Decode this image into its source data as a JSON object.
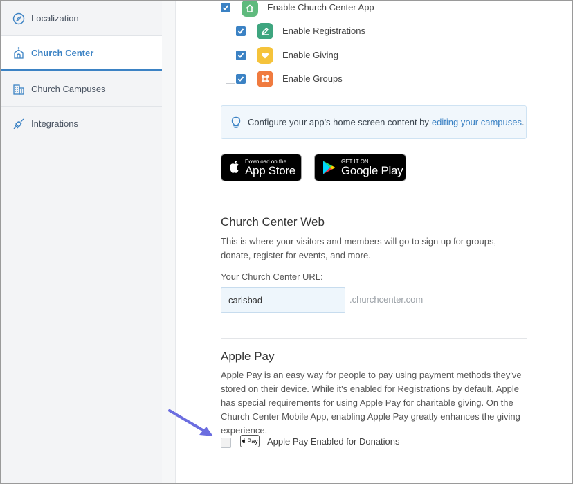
{
  "sidebar": {
    "items": [
      {
        "label": "Localization",
        "icon": "compass-icon"
      },
      {
        "label": "Church Center",
        "icon": "church-icon",
        "active": true
      },
      {
        "label": "Church Campuses",
        "icon": "building-icon"
      },
      {
        "label": "Integrations",
        "icon": "plug-icon"
      }
    ]
  },
  "app_options": {
    "main": {
      "label": "Enable Church Center App",
      "checked": true,
      "icon": "home-icon",
      "color": "#5fba7d"
    },
    "children": [
      {
        "label": "Enable Registrations",
        "checked": true,
        "icon": "pencil-icon",
        "color": "#3ea57f"
      },
      {
        "label": "Enable Giving",
        "checked": true,
        "icon": "heart-icon",
        "color": "#f5c33b"
      },
      {
        "label": "Enable Groups",
        "checked": true,
        "icon": "groups-icon",
        "color": "#f07b3f"
      }
    ]
  },
  "info": {
    "text": "Configure your app's home screen content by",
    "link": "editing your campuses",
    "suffix": "."
  },
  "stores": {
    "apple_small": "Download on the",
    "apple_big": "App Store",
    "google_small": "GET IT ON",
    "google_big": "Google Play"
  },
  "web": {
    "heading": "Church Center Web",
    "description": "This is where your visitors and members will go to sign up for groups, donate, register for events, and more.",
    "url_label": "Your Church Center URL:",
    "url_value": "carlsbad",
    "url_suffix": ".churchcenter.com"
  },
  "apple_pay": {
    "heading": "Apple Pay",
    "description": "Apple Pay is an easy way for people to pay using payment methods they've stored on their device. While it's enabled for Registrations by default, Apple has special requirements for using Apple Pay for charitable giving. On the Church Center Mobile App, enabling Apple Pay greatly enhances the giving experience.",
    "mark": "Pay",
    "checkbox_label": "Apple Pay Enabled for Donations",
    "checked": false
  },
  "colors": {
    "accent": "#3b82c4",
    "annotation_arrow": "#6b6de0"
  }
}
